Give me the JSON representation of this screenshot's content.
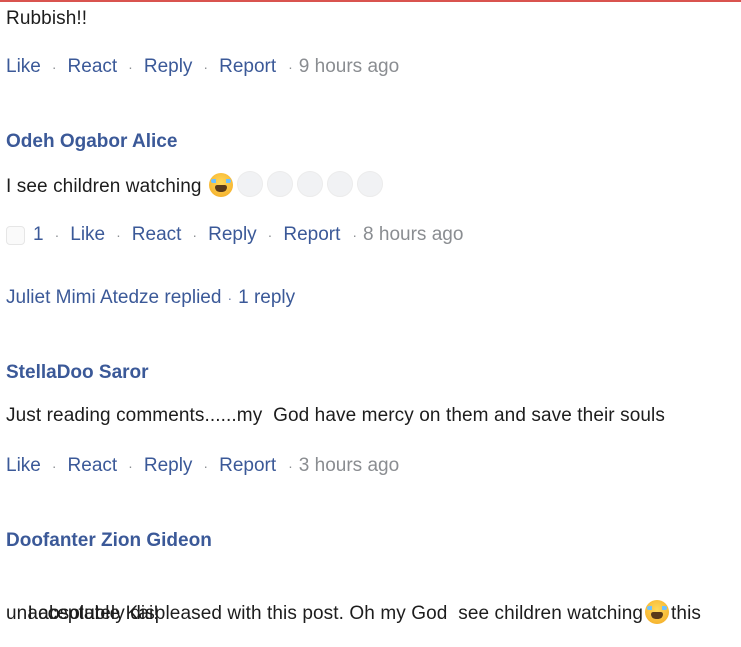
{
  "comments": [
    {
      "author": "",
      "text": "Rubbish!!",
      "actions": {
        "like": "Like",
        "react": "React",
        "reply": "Reply",
        "report": "Report"
      },
      "time": "9 hours ago"
    },
    {
      "author": "Odeh Ogabor Alice",
      "text": "I see children watching",
      "reaction_count": "1",
      "actions": {
        "like": "Like",
        "react": "React",
        "reply": "Reply",
        "report": "Report"
      },
      "time": "8 hours ago",
      "replies": {
        "summary": "Juliet Mimi Atedze replied",
        "count": "1 reply"
      }
    },
    {
      "author": "StellaDoo Saror",
      "text": "Just reading comments......my  God have mercy on them and save their souls",
      "actions": {
        "like": "Like",
        "react": "React",
        "reply": "Reply",
        "report": "Report"
      },
      "time": "3 hours ago"
    },
    {
      "author": "Doofanter Zion Gideon",
      "text_before": "I absolutely displeased with this post. Oh my God  see children watching",
      "text_after": "this",
      "text_line2": "unacceptable Kai!"
    }
  ],
  "icons": {
    "crying_emoji": "loudly-crying-face-icon",
    "reaction_chip": "reaction-icon"
  },
  "colors": {
    "link": "#3b5998",
    "muted": "#8a8d91",
    "accent_rule": "#d9534f"
  }
}
